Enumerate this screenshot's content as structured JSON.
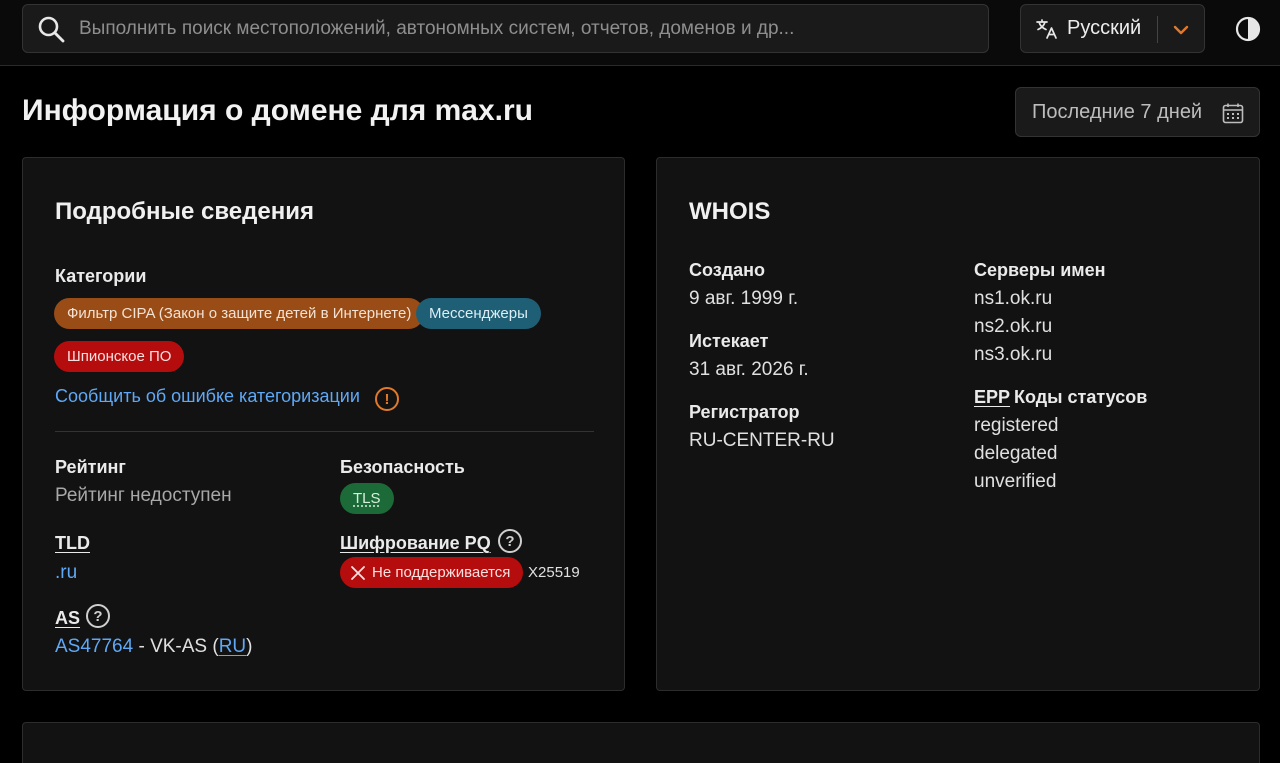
{
  "header": {
    "search_placeholder": "Выполнить поиск местоположений, автономных систем, отчетов, доменов и др...",
    "language_label": "Русский"
  },
  "page": {
    "title": "Информация о домене для max.ru",
    "date_range": "Последние 7 дней"
  },
  "details": {
    "title": "Подробные сведения",
    "categories_label": "Категории",
    "categories": [
      {
        "label": "Фильтр CIPA (Закон о защите детей в Интернете)",
        "color": "#9a4c17"
      },
      {
        "label": "Мессенджеры",
        "color": "#1f5f75"
      },
      {
        "label": "Шпионское ПО",
        "color": "#b50d0d"
      }
    ],
    "report_link": "Сообщить об ошибке категоризации",
    "rating_label": "Рейтинг",
    "rating_value": "Рейтинг недоступен",
    "security_label": "Безопасность",
    "security_badge": "TLS",
    "tld_label": "TLD",
    "tld_value": ".ru",
    "pq_label": "Шифрование PQ",
    "pq_badge": "Не поддерживается",
    "pq_extra": "X25519",
    "as_label": "AS",
    "as_number": "AS47764",
    "as_name": " - VK-AS (",
    "as_country": "RU",
    "as_close": ")"
  },
  "whois": {
    "title": "WHOIS",
    "created_label": "Создано",
    "created_value": "9 авг. 1999 г.",
    "expires_label": "Истекает",
    "expires_value": "31 авг. 2026 г.",
    "registrar_label": "Регистратор",
    "registrar_value": "RU-CENTER-RU",
    "nameservers_label": "Серверы имен",
    "nameservers": [
      "ns1.ok.ru",
      "ns2.ok.ru",
      "ns3.ok.ru"
    ],
    "epp_label": "EPP",
    "status_label": "Коды статусов",
    "statuses": [
      "registered",
      "delegated",
      "unverified"
    ]
  },
  "colors": {
    "accent_link": "#5fa8f5",
    "warn": "#e07a2a"
  }
}
